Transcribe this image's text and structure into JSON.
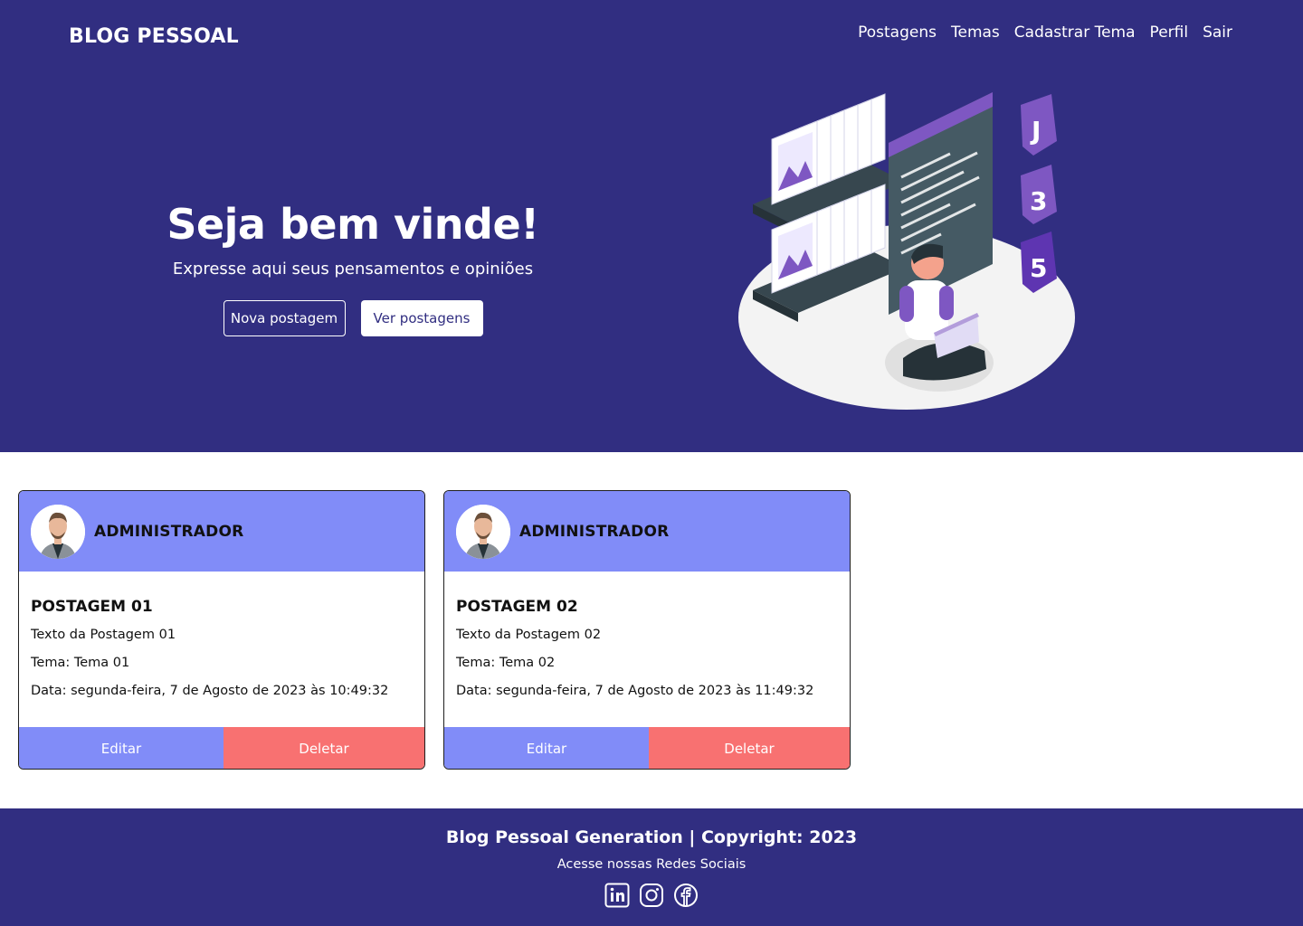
{
  "header": {
    "brand": "BLOG PESSOAL",
    "nav": [
      "Postagens",
      "Temas",
      "Cadastrar Tema",
      "Perfil",
      "Sair"
    ]
  },
  "hero": {
    "title": "Seja bem vinde!",
    "subtitle": "Expresse aqui seus pensamentos e opiniões",
    "new_post_label": "Nova postagem",
    "view_posts_label": "Ver postagens"
  },
  "posts": [
    {
      "author": "ADMINISTRADOR",
      "title": "POSTAGEM 01",
      "text": "Texto da Postagem 01",
      "theme": "Tema: Tema 01",
      "date": "Data: segunda-feira, 7 de Agosto de 2023 às 10:49:32",
      "edit_label": "Editar",
      "delete_label": "Deletar"
    },
    {
      "author": "ADMINISTRADOR",
      "title": "POSTAGEM 02",
      "text": "Texto da Postagem 02",
      "theme": "Tema: Tema 02",
      "date": "Data: segunda-feira, 7 de Agosto de 2023 às 11:49:32",
      "edit_label": "Editar",
      "delete_label": "Deletar"
    }
  ],
  "footer": {
    "title": "Blog Pessoal Generation | Copyright: 2023",
    "subtitle": "Acesse nossas Redes Sociais",
    "socials": [
      "linkedin-icon",
      "instagram-icon",
      "facebook-icon"
    ]
  },
  "colors": {
    "primary": "#312e81",
    "card_header": "#818cf8",
    "edit": "#818cf8",
    "delete": "#f87171"
  }
}
